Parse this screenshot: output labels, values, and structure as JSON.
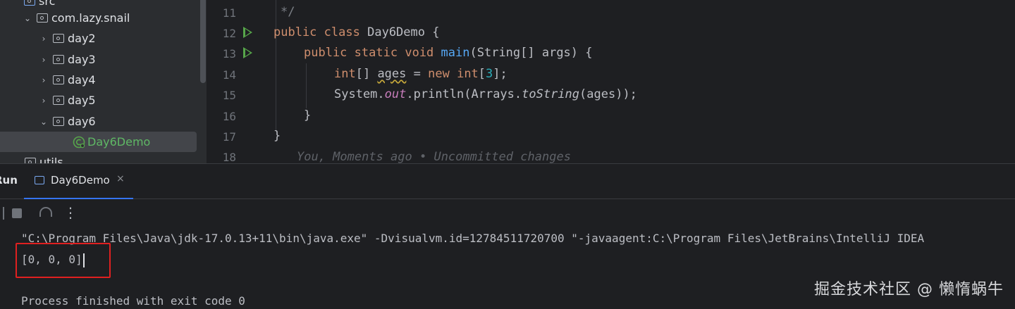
{
  "project_tree": {
    "items": [
      {
        "label": "src"
      },
      {
        "label": "com.lazy.snail"
      },
      {
        "label": "day2"
      },
      {
        "label": "day3"
      },
      {
        "label": "day4"
      },
      {
        "label": "day5"
      },
      {
        "label": "day6"
      },
      {
        "label": "Day6Demo"
      },
      {
        "label": "utils"
      }
    ]
  },
  "editor": {
    "line_numbers": [
      "11",
      "12",
      "13",
      "14",
      "15",
      "16",
      "17",
      "18"
    ],
    "lines": {
      "l11": "*/",
      "l12": {
        "kw1": "public",
        "kw2": "class",
        "name": "Day6Demo",
        "brace": "{"
      },
      "l13": {
        "kw1": "public",
        "kw2": "static",
        "kw3": "void",
        "fn": "main",
        "params": "(String[] args) {"
      },
      "l14": {
        "type": "int",
        "bracket": "[] ",
        "var": "ages",
        "assign": " = ",
        "kw": "new",
        "type2": "int",
        "open": "[",
        "num": "3",
        "close": "];"
      },
      "l15": {
        "obj": "System.",
        "field": "out",
        "call": ".println(Arrays.",
        "method": "toString",
        "args": "(ages));"
      },
      "l16": "}",
      "l17": "}",
      "l18": "You, Moments ago • Uncommitted changes"
    }
  },
  "run_panel": {
    "title": "Run",
    "tab_label": "Day6Demo",
    "close_glyph": "×",
    "more_glyph": "⋮",
    "output": {
      "command": "\"C:\\Program Files\\Java\\jdk-17.0.13+11\\bin\\java.exe\" -Dvisualvm.id=12784511720700 \"-javaagent:C:\\Program Files\\JetBrains\\IntelliJ IDEA",
      "result": "[0, 0, 0]",
      "exit": "Process finished with exit code 0"
    }
  },
  "watermark": "掘金技术社区 @ 懒惰蜗牛",
  "colors": {
    "accent": "#3574f0",
    "highlight_box": "#e02020",
    "run_icon": "#57a64a"
  }
}
